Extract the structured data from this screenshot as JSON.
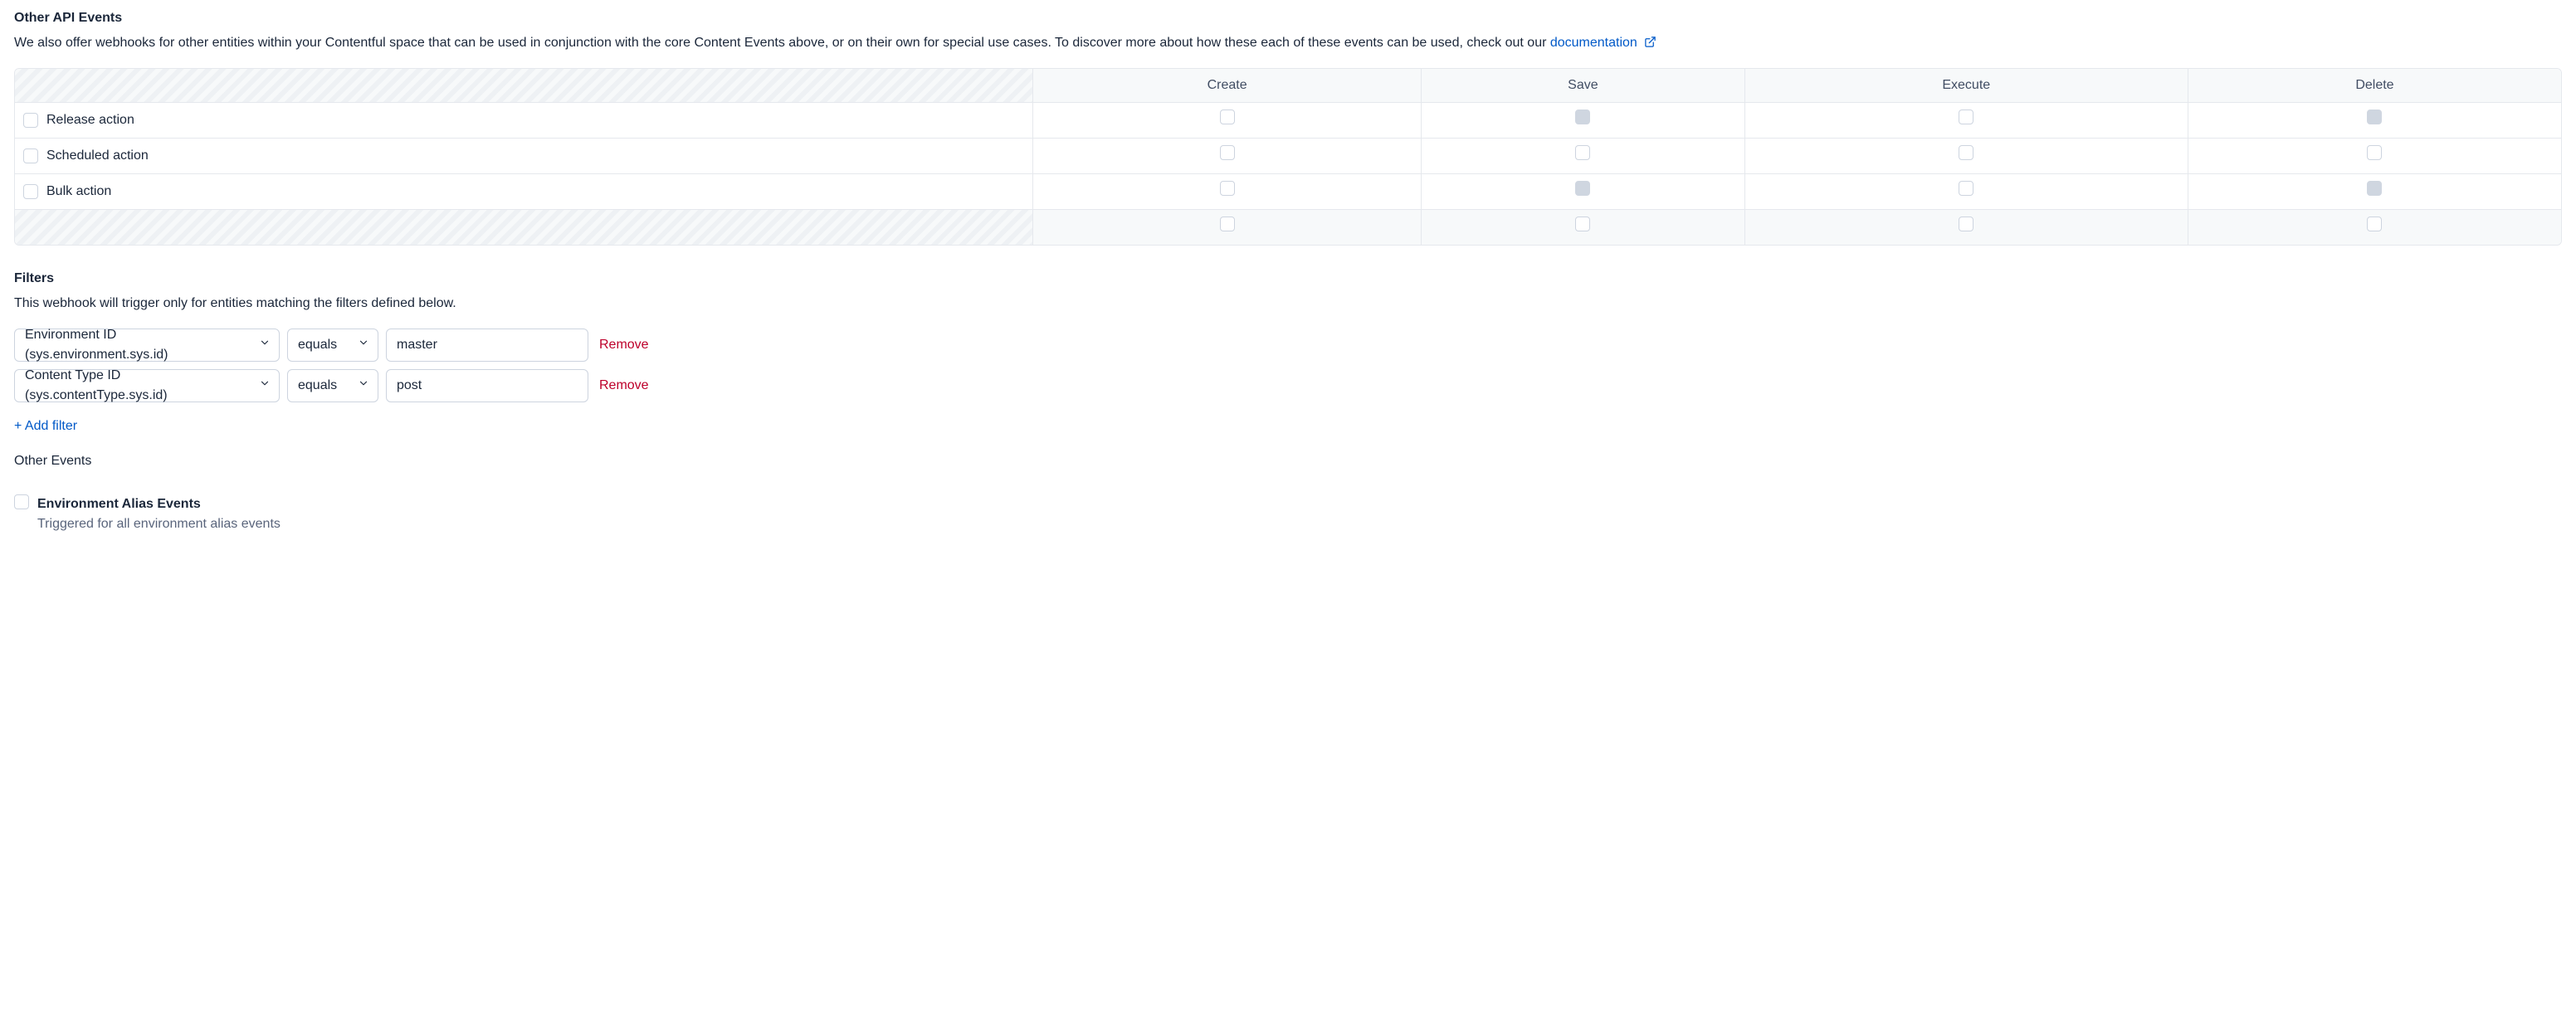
{
  "section_title": "Other API Events",
  "section_desc_prefix": "We also offer webhooks for other entities within your Contentful space that can be used in conjunction with the core Content Events above, or on their own for special use cases. To discover more about how these each of these events can be used, check out our ",
  "documentation_link": "documentation",
  "table": {
    "columns": [
      "Create",
      "Save",
      "Execute",
      "Delete"
    ],
    "rows": [
      {
        "label": "Release action",
        "cells": [
          {
            "disabled": false
          },
          {
            "disabled": true
          },
          {
            "disabled": false
          },
          {
            "disabled": true
          }
        ]
      },
      {
        "label": "Scheduled action",
        "cells": [
          {
            "disabled": false
          },
          {
            "disabled": false
          },
          {
            "disabled": false
          },
          {
            "disabled": false
          }
        ]
      },
      {
        "label": "Bulk action",
        "cells": [
          {
            "disabled": false
          },
          {
            "disabled": true
          },
          {
            "disabled": false
          },
          {
            "disabled": true
          }
        ]
      }
    ],
    "footer_cells": [
      {
        "disabled": false
      },
      {
        "disabled": false
      },
      {
        "disabled": false
      },
      {
        "disabled": false
      }
    ]
  },
  "filters_heading": "Filters",
  "filters_desc": "This webhook will trigger only for entities matching the filters defined below.",
  "filters": [
    {
      "field": "Environment ID (sys.environment.sys.id)",
      "op": "equals",
      "value": "master",
      "remove": "Remove"
    },
    {
      "field": "Content Type ID (sys.contentType.sys.id)",
      "op": "equals",
      "value": "post",
      "remove": "Remove"
    }
  ],
  "add_filter": "+ Add filter",
  "other_events_title": "Other Events",
  "alias": {
    "title": "Environment Alias Events",
    "desc": "Triggered for all environment alias events"
  }
}
